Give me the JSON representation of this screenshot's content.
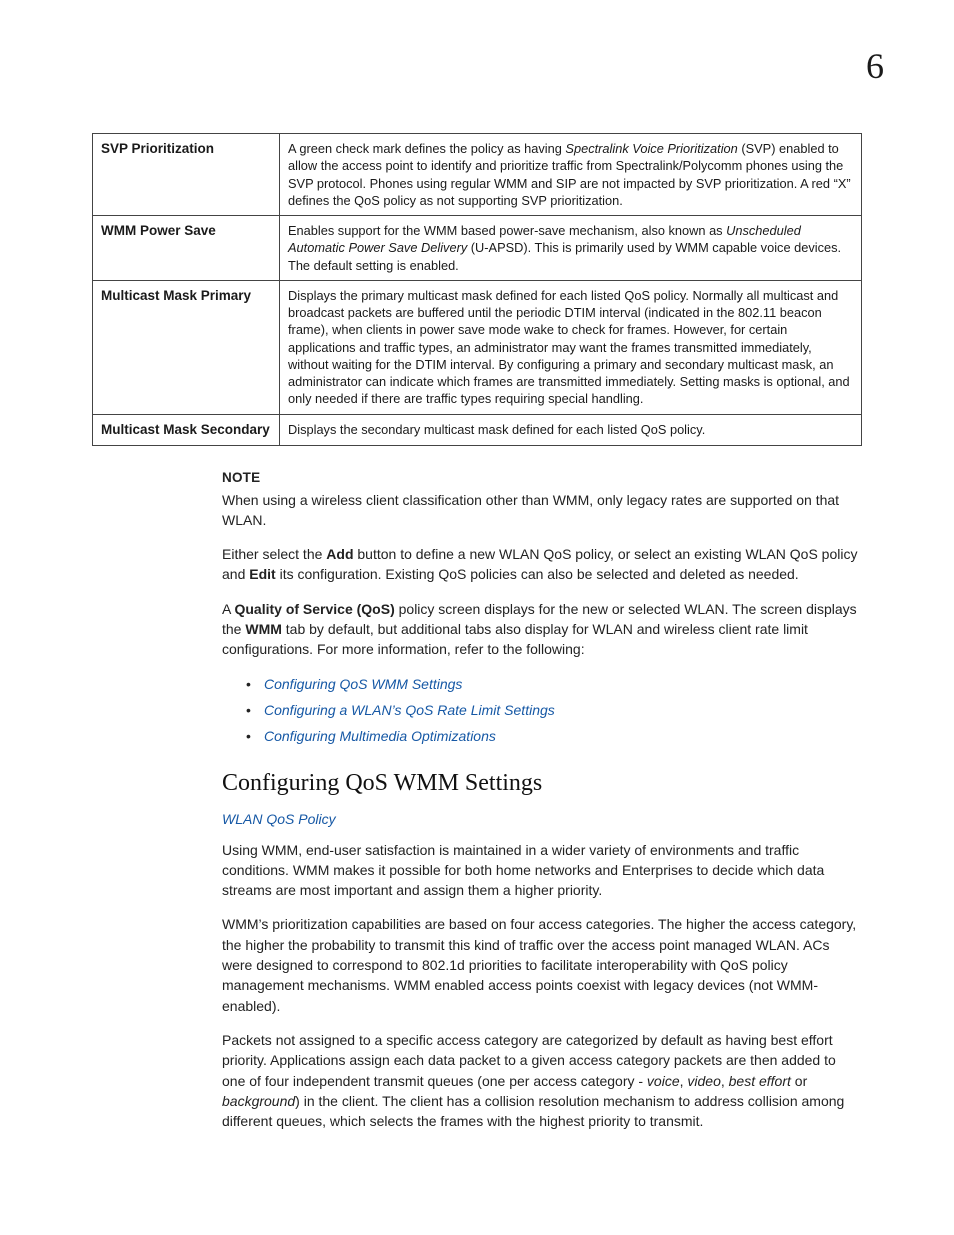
{
  "chapter_number": "6",
  "table": {
    "rows": [
      {
        "term": "SVP Prioritization",
        "def_pre": "A green check mark defines the policy as having ",
        "def_em1": "Spectralink Voice Prioritization",
        "def_mid": " (SVP) enabled to allow the access point to identify and prioritize traffic from Spectralink/Polycomm phones using the SVP protocol. Phones using regular WMM and SIP are not impacted by SVP prioritization. A red “X” defines the QoS policy as not supporting SVP prioritization.",
        "def_em2": "",
        "def_post": ""
      },
      {
        "term": "WMM Power Save",
        "def_pre": "Enables support for the WMM based power-save mechanism, also known as ",
        "def_em1": "Unscheduled Automatic Power Save Delivery",
        "def_mid": " (U-APSD). This is primarily used by WMM capable voice devices. The default setting is enabled.",
        "def_em2": "",
        "def_post": ""
      },
      {
        "term": "Multicast Mask Primary",
        "def_pre": "Displays the primary multicast mask defined for each listed QoS policy. Normally all multicast and broadcast packets are buffered until the periodic DTIM interval (indicated in the 802.11 beacon frame), when clients in power save mode wake to check for frames. However, for certain applications and traffic types, an administrator may want the frames transmitted immediately, without waiting for the DTIM interval. By configuring a primary and secondary multicast mask, an administrator can indicate which frames are transmitted immediately. Setting masks is optional, and only needed if there are traffic types requiring special handling.",
        "def_em1": "",
        "def_mid": "",
        "def_em2": "",
        "def_post": ""
      },
      {
        "term": "Multicast Mask Secondary",
        "def_pre": "Displays the secondary multicast mask defined for each listed QoS policy.",
        "def_em1": "",
        "def_mid": "",
        "def_em2": "",
        "def_post": ""
      }
    ]
  },
  "note": {
    "head": "NOTE",
    "body": "When using a wireless client classification other than WMM, only legacy rates are supported on that WLAN."
  },
  "para_select": {
    "p1": "Either select the ",
    "b1": "Add",
    "p2": " button to define a new WLAN QoS policy, or select an existing WLAN QoS policy and ",
    "b2": "Edit",
    "p3": " its configuration. Existing QoS policies can also be selected and deleted as needed."
  },
  "para_qos": {
    "p1": "A ",
    "b1": "Quality of Service (QoS)",
    "p2": " policy screen displays for the new or selected WLAN. The screen displays the ",
    "b2": "WMM",
    "p3": " tab by default, but additional tabs also display for WLAN and wireless client rate limit configurations. For more information, refer to the following:"
  },
  "links": [
    "Configuring QoS WMM Settings",
    "Configuring a WLAN’s QoS Rate Limit Settings",
    "Configuring Multimedia Optimizations"
  ],
  "section": {
    "title": "Configuring QoS WMM Settings",
    "sublink": "WLAN QoS Policy",
    "p1": "Using WMM, end-user satisfaction is maintained in a wider variety of environments and traffic conditions. WMM makes it possible for both home networks and Enterprises to decide which data streams are most important and assign them a higher priority.",
    "p2": "WMM’s prioritization capabilities are based on four access categories. The higher the access category, the higher the probability to transmit this kind of traffic over the access point managed WLAN. ACs were designed to correspond to 802.1d priorities to facilitate interoperability with QoS policy management mechanisms. WMM enabled access points coexist with legacy devices (not WMM-enabled).",
    "p3_pre": "Packets not assigned to a specific access category are categorized by default as having best effort priority. Applications assign each data packet to a given access category packets are then added to one of four independent transmit queues (one per access category - ",
    "p3_i1": "voice",
    "p3_s1": ", ",
    "p3_i2": "video",
    "p3_s2": ", ",
    "p3_i3": "best effort",
    "p3_s3": " or ",
    "p3_i4": "background",
    "p3_post": ") in the client. The client has a collision resolution mechanism to address collision among different queues, which selects the frames with the highest priority to transmit."
  }
}
